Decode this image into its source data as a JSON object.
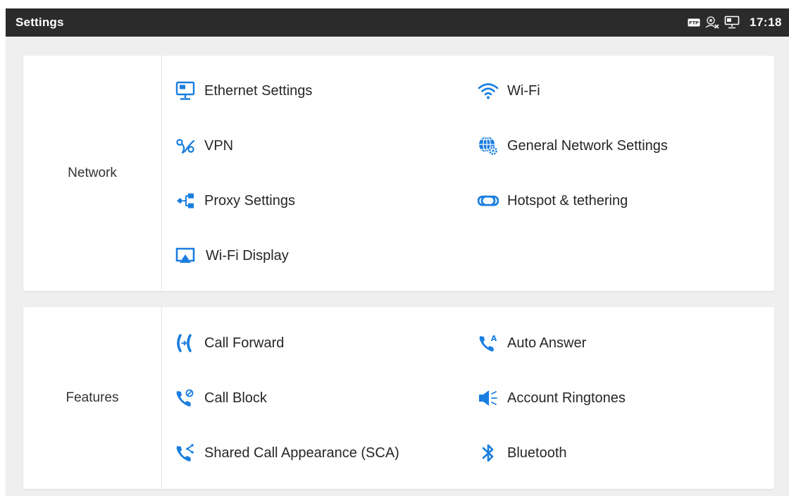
{
  "app": {
    "title": "Settings"
  },
  "status": {
    "time": "17:18",
    "icons": [
      "ftp-icon",
      "account-off-icon",
      "ethernet-icon"
    ]
  },
  "accent_color": "#1a7ee0",
  "sections": {
    "network": {
      "label": "Network",
      "items": {
        "ethernet": {
          "label": "Ethernet Settings",
          "icon": "ethernet-icon"
        },
        "wifi": {
          "label": "Wi-Fi",
          "icon": "wifi-icon"
        },
        "vpn": {
          "label": "VPN",
          "icon": "vpn-icon"
        },
        "general": {
          "label": "General Network Settings",
          "icon": "globe-gear-icon"
        },
        "proxy": {
          "label": "Proxy Settings",
          "icon": "proxy-icon"
        },
        "hotspot": {
          "label": "Hotspot & tethering",
          "icon": "hotspot-icon"
        },
        "wifidisplay": {
          "label": "Wi-Fi Display",
          "icon": "cast-icon"
        }
      }
    },
    "features": {
      "label": "Features",
      "items": {
        "callforward": {
          "label": "Call Forward",
          "icon": "call-forward-icon"
        },
        "autoanswer": {
          "label": "Auto Answer",
          "icon": "auto-answer-icon"
        },
        "callblock": {
          "label": "Call Block",
          "icon": "call-block-icon"
        },
        "ringtones": {
          "label": "Account Ringtones",
          "icon": "speaker-icon"
        },
        "sca": {
          "label": "Shared Call Appearance (SCA)",
          "icon": "shared-call-icon"
        },
        "bluetooth": {
          "label": "Bluetooth",
          "icon": "bluetooth-icon"
        }
      }
    }
  }
}
